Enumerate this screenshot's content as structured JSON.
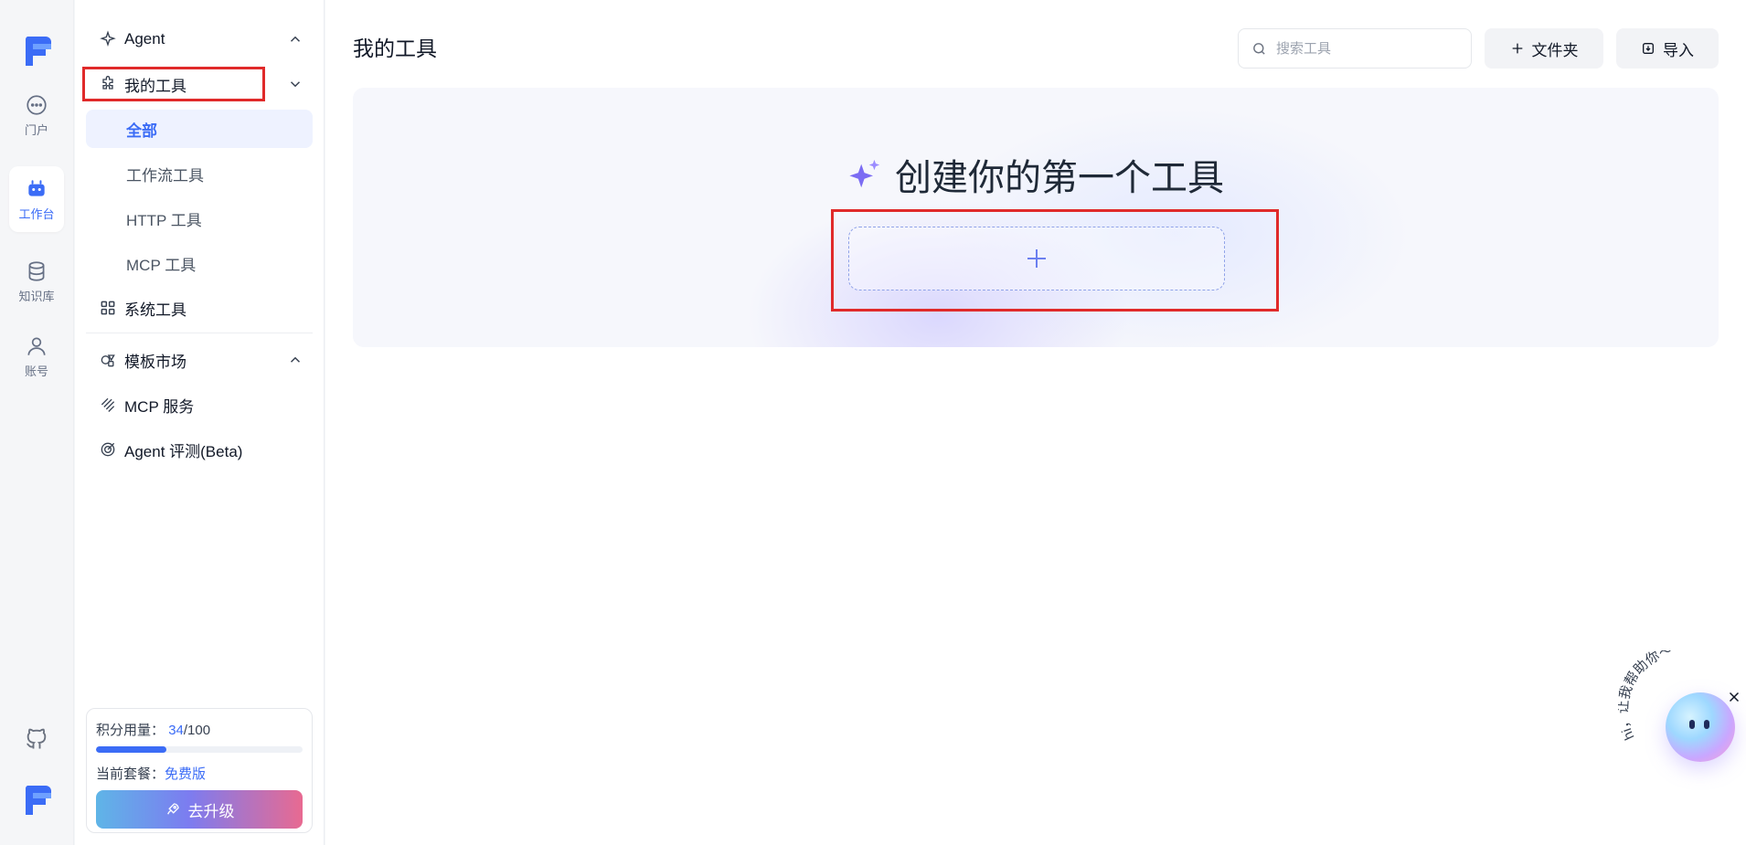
{
  "rail": {
    "items": [
      {
        "label": "门户",
        "icon": "chat-icon"
      },
      {
        "label": "工作台",
        "icon": "robot-icon"
      },
      {
        "label": "知识库",
        "icon": "database-icon"
      },
      {
        "label": "账号",
        "icon": "user-icon"
      }
    ]
  },
  "subnav": {
    "agent": "Agent",
    "my_tools": "我的工具",
    "all": "全部",
    "workflow_tools": "工作流工具",
    "http_tools": "HTTP 工具",
    "mcp_tools": "MCP 工具",
    "system_tools": "系统工具",
    "template_market": "模板市场",
    "mcp_service": "MCP 服务",
    "agent_eval": "Agent 评测(Beta)"
  },
  "usage": {
    "label": "积分用量：",
    "used": "34",
    "total": "/100",
    "fraction": 0.34,
    "plan_label": "当前套餐：",
    "plan_value": "免费版",
    "upgrade": "去升级"
  },
  "main": {
    "title": "我的工具",
    "search_placeholder": "搜索工具",
    "folder_button": "文件夹",
    "import_button": "导入",
    "hero_title": "创建你的第一个工具"
  },
  "assistant": {
    "greeting": "hi，让我帮助你～"
  },
  "colors": {
    "accent": "#3b6cf6",
    "highlight": "#e02a2a"
  }
}
